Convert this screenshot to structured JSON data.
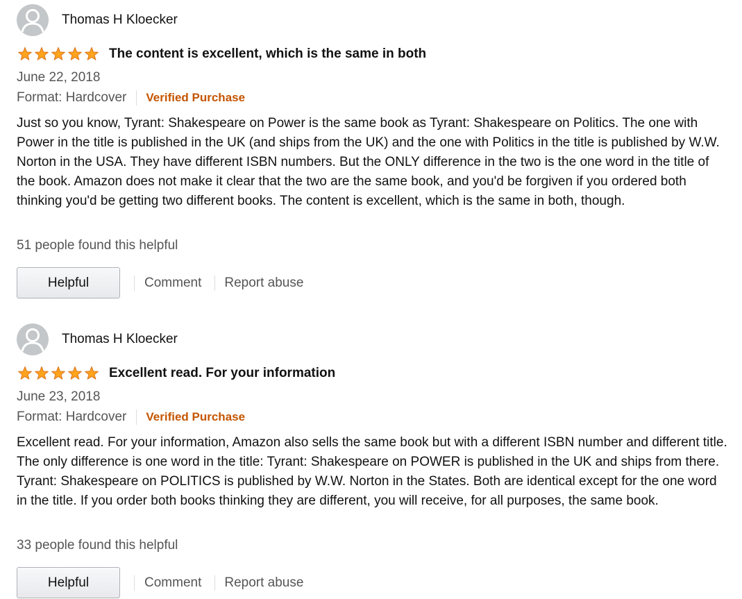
{
  "colors": {
    "verified": "#c45500",
    "star": "#ffa41c",
    "star_outline": "#de7921",
    "muted_text": "#555555"
  },
  "reviews": [
    {
      "reviewer": "Thomas H Kloecker",
      "rating": 5,
      "title": "The content is excellent, which is the same in both",
      "date": "June 22, 2018",
      "format": "Format: Hardcover",
      "verified": "Verified Purchase",
      "body": "Just so you know, Tyrant: Shakespeare on Power is the same book as Tyrant: Shakespeare on Politics. The one with Power in the title is published in the UK (and ships from the UK) and the one with Politics in the title is published by W.W. Norton in the USA. They have different ISBN numbers. But the ONLY difference in the two is the one word in the title of the book. Amazon does not make it clear that the two are the same book, and you'd be forgiven if you ordered both thinking you'd be getting two different books. The content is excellent, which is the same in both, though.",
      "helpful_count": "51 people found this helpful",
      "helpful_button": "Helpful",
      "comment_label": "Comment",
      "report_label": "Report abuse"
    },
    {
      "reviewer": "Thomas H Kloecker",
      "rating": 5,
      "title": "Excellent read. For your information",
      "date": "June 23, 2018",
      "format": "Format: Hardcover",
      "verified": "Verified Purchase",
      "body": "Excellent read. For your information, Amazon also sells the same book but with a different ISBN number and different title. The only difference is one word in the title: Tyrant: Shakespeare on POWER is published in the UK and ships from there. Tyrant: Shakespeare on POLITICS is published by W.W. Norton in the States. Both are identical except for the one word in the title. If you order both books thinking they are different, you will receive, for all purposes, the same book.",
      "helpful_count": "33 people found this helpful",
      "helpful_button": "Helpful",
      "comment_label": "Comment",
      "report_label": "Report abuse"
    }
  ]
}
